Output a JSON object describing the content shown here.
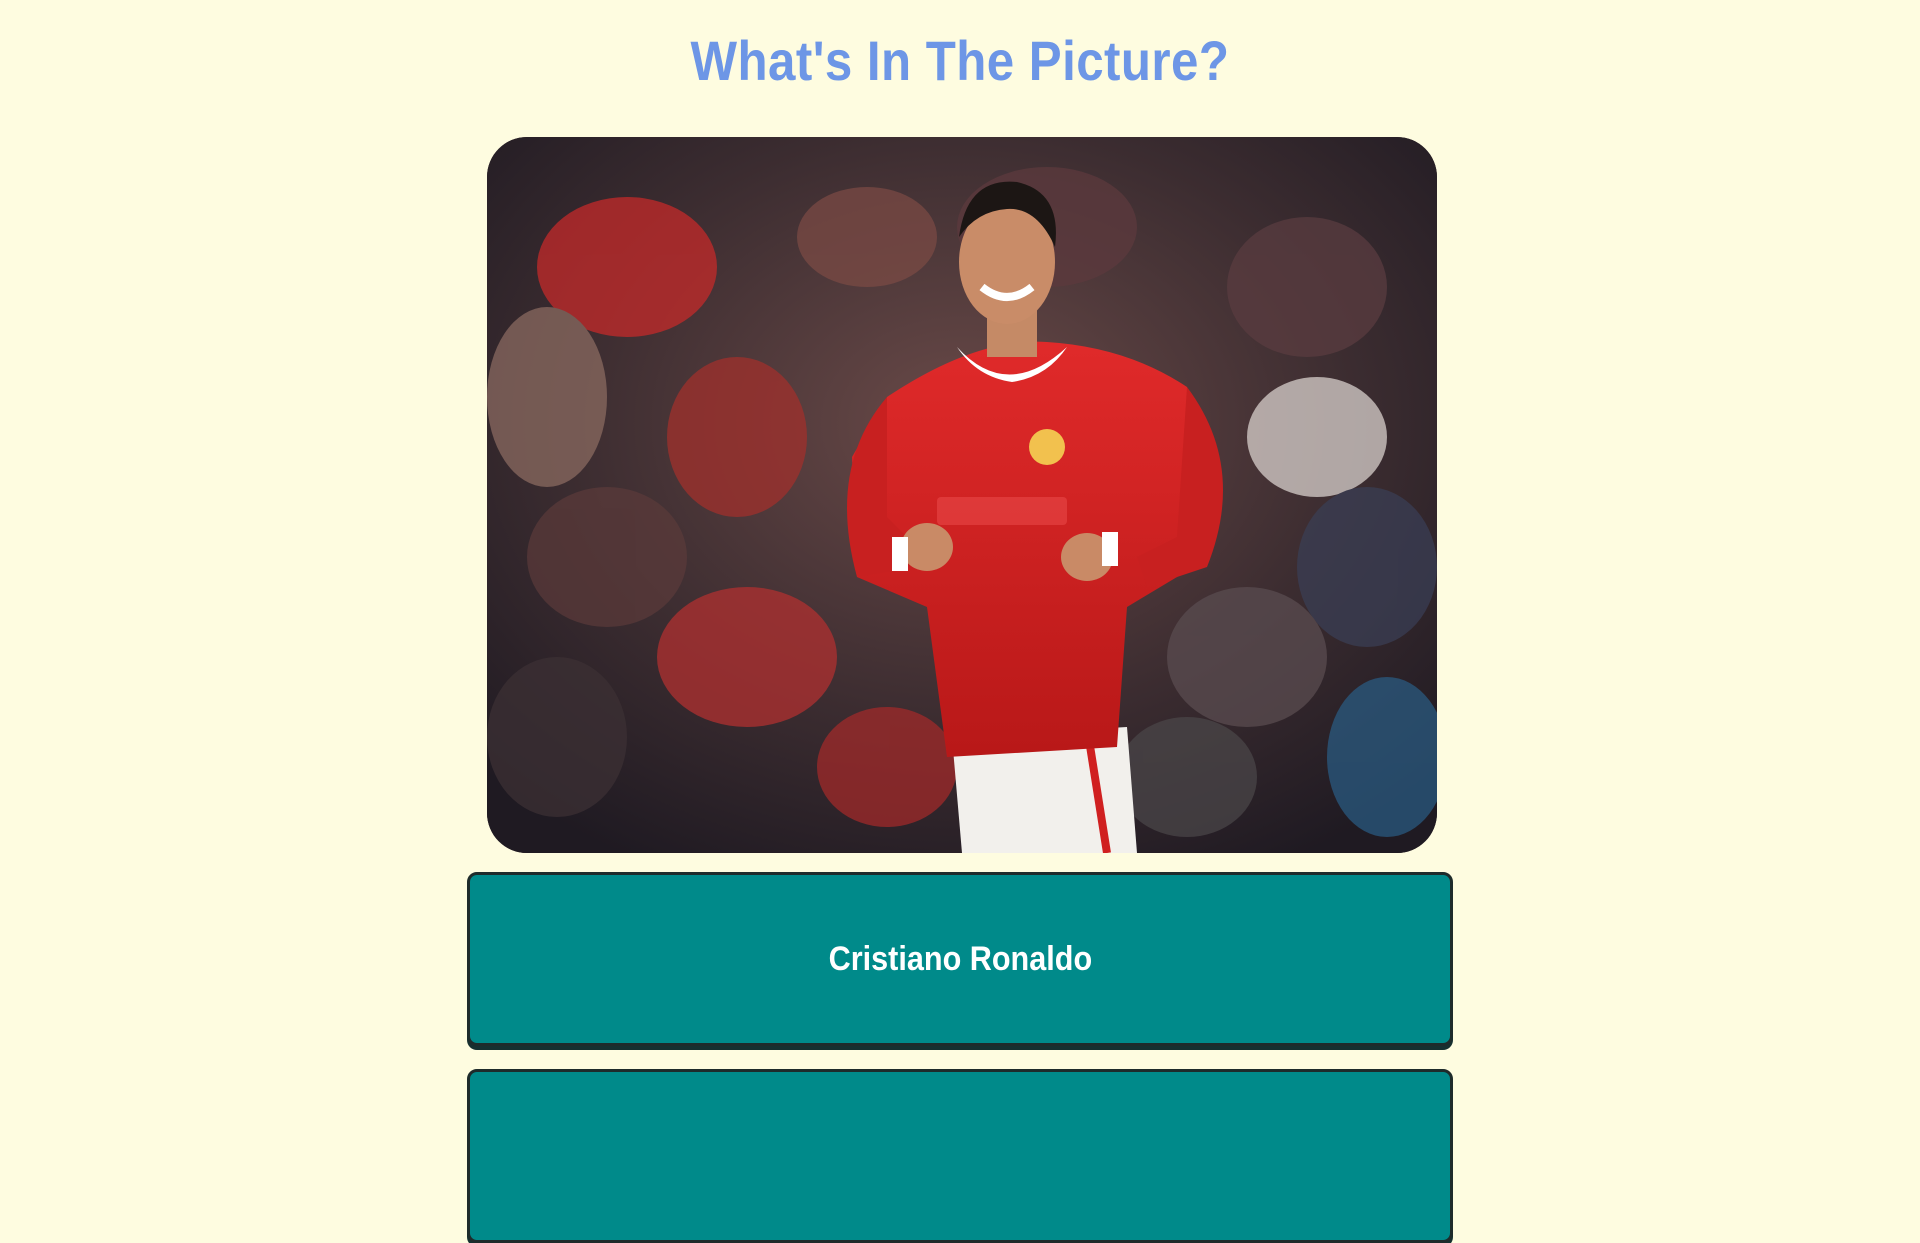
{
  "quiz": {
    "title": "What's In The Picture?",
    "image_icon": "football-player-photo",
    "answers": [
      {
        "label": "Cristiano Ronaldo"
      },
      {
        "label": ""
      }
    ],
    "colors": {
      "background": "#fefce0",
      "title": "#6d96e6",
      "answer_button": "#008a8a",
      "answer_text": "#ffffff"
    }
  }
}
